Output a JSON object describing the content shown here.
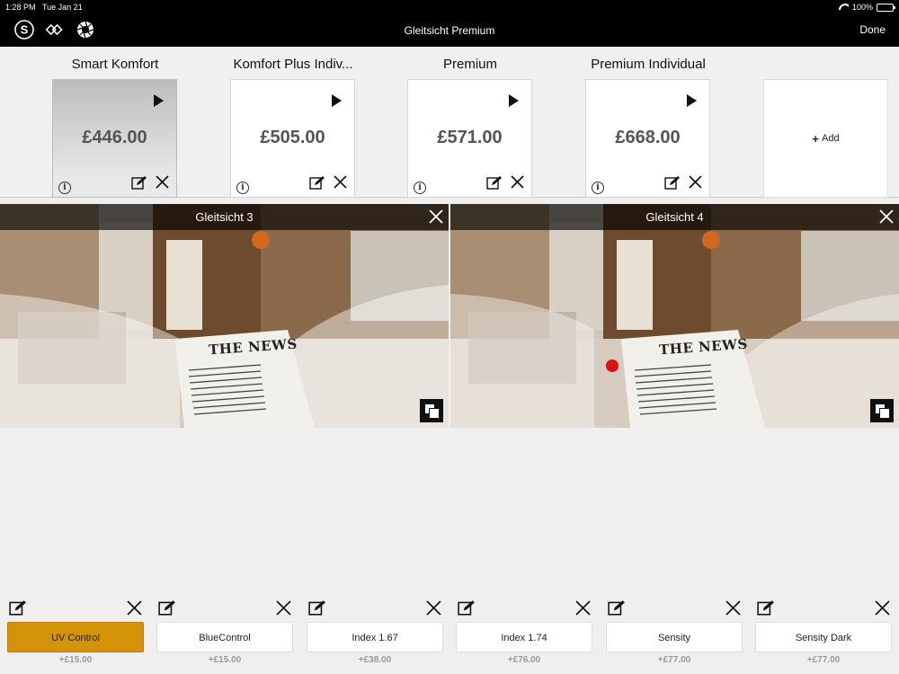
{
  "status": {
    "time": "1:28 PM",
    "date": "Tue Jan 21",
    "battery": "100%",
    "battery_level": 1.0
  },
  "nav": {
    "title": "Gleitsicht Premium",
    "done_label": "Done"
  },
  "tiles": [
    {
      "name": "Smart  Komfort",
      "price": "£446.00",
      "selected": true
    },
    {
      "name": "Komfort Plus Indiv...",
      "price": "£505.00",
      "selected": false
    },
    {
      "name": "Premium",
      "price": "£571.00",
      "selected": false
    },
    {
      "name": "Premium Individual",
      "price": "£668.00",
      "selected": false
    }
  ],
  "add_tile": {
    "label": "Add"
  },
  "panels": [
    {
      "title": "Gleitsicht 3",
      "headline": "THE NEWS"
    },
    {
      "title": "Gleitsicht 4",
      "headline": "THE NEWS"
    }
  ],
  "options": [
    {
      "label": "UV Control",
      "price": "+£15.00",
      "active": true
    },
    {
      "label": "BlueControl",
      "price": "+£15.00",
      "active": false
    },
    {
      "label": "Index 1.67",
      "price": "+£38.00",
      "active": false
    },
    {
      "label": "Index 1.74",
      "price": "+£76.00",
      "active": false
    },
    {
      "label": "Sensity",
      "price": "+£77.00",
      "active": false
    },
    {
      "label": "Sensity Dark",
      "price": "+£77.00",
      "active": false
    }
  ],
  "colors": {
    "accent": "#d4940a",
    "nav_bg": "#000000",
    "background": "#efefef"
  }
}
